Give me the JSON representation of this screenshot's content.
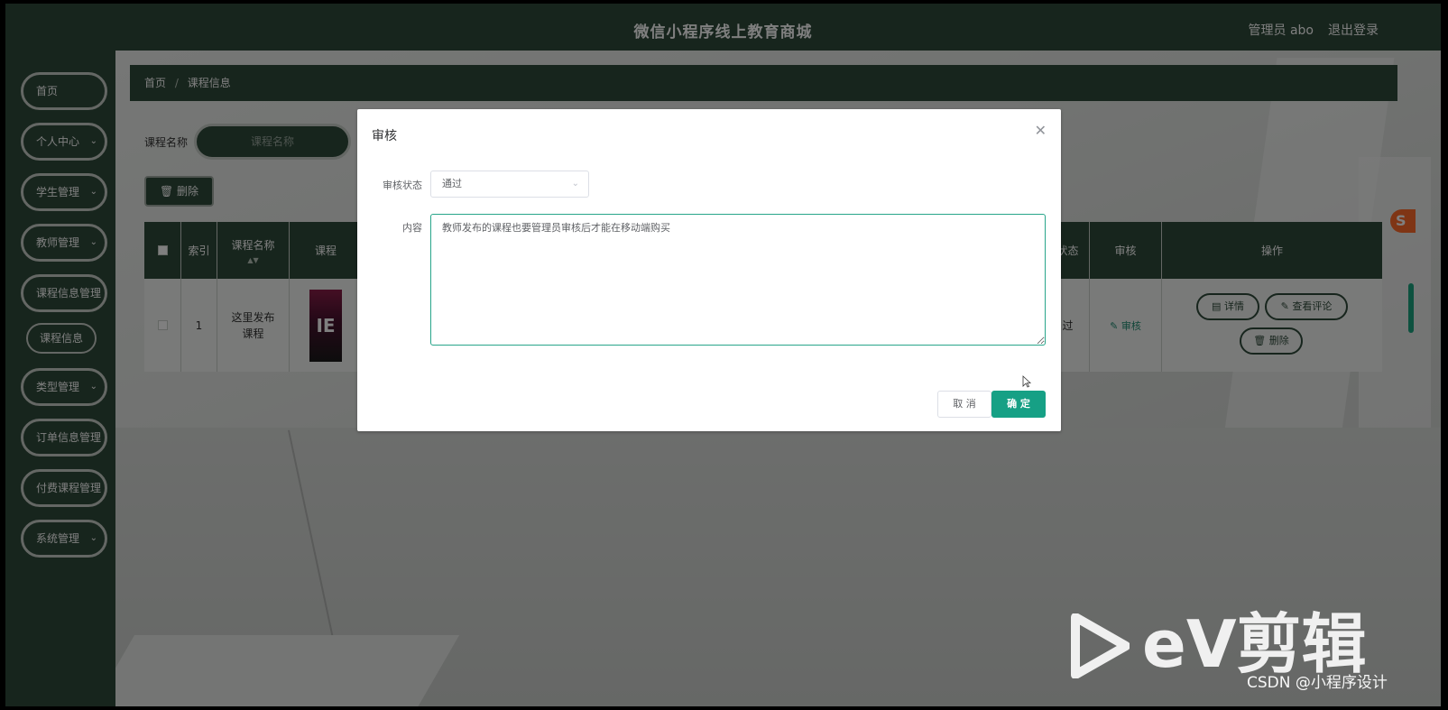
{
  "app": {
    "title": "微信小程序线上教育商城",
    "user_label": "管理员 abo",
    "logout_label": "退出登录"
  },
  "sidebar": {
    "items": [
      {
        "label": "首页",
        "chevron": ""
      },
      {
        "label": "个人中心",
        "chevron": "⌄"
      },
      {
        "label": "学生管理",
        "chevron": "⌄"
      },
      {
        "label": "教师管理",
        "chevron": "⌄"
      },
      {
        "label": "课程信息管理",
        "chevron": "⌄"
      },
      {
        "label": "类型管理",
        "chevron": "⌄"
      },
      {
        "label": "订单信息管理",
        "chevron": "⌄"
      },
      {
        "label": "付费课程管理",
        "chevron": "⌄"
      },
      {
        "label": "系统管理",
        "chevron": "⌄"
      }
    ],
    "subitem": "课程信息"
  },
  "breadcrumb": {
    "home": "首页",
    "separator": "/",
    "current": "课程信息"
  },
  "search": {
    "label": "课程名称",
    "placeholder": "课程名称"
  },
  "toolbar": {
    "delete_label": "删除"
  },
  "table": {
    "headers": {
      "index": "索引",
      "course_name": "课程名称",
      "course_cover": "课程",
      "status": "状态",
      "audit": "审核",
      "actions": "操作"
    },
    "rows": [
      {
        "index": "1",
        "course_name": "这里发布课程",
        "cover_text": "IE",
        "status": "过",
        "audit_link": "审核",
        "actions": {
          "detail": "详情",
          "comments": "查看评论",
          "delete": "删除"
        }
      }
    ]
  },
  "dialog": {
    "title": "审核",
    "status_label": "审核状态",
    "status_value": "通过",
    "content_label": "内容",
    "content_value": "教师发布的课程也要管理员审核后才能在移动端购买",
    "cancel_label": "取 消",
    "confirm_label": "确 定"
  },
  "watermark": {
    "brand": "eV剪辑",
    "credit": "CSDN @小程序设计"
  },
  "colors": {
    "primary_dark": "#2f4a3a",
    "accent": "#16a085",
    "ime_badge": "#ff6a2a"
  }
}
